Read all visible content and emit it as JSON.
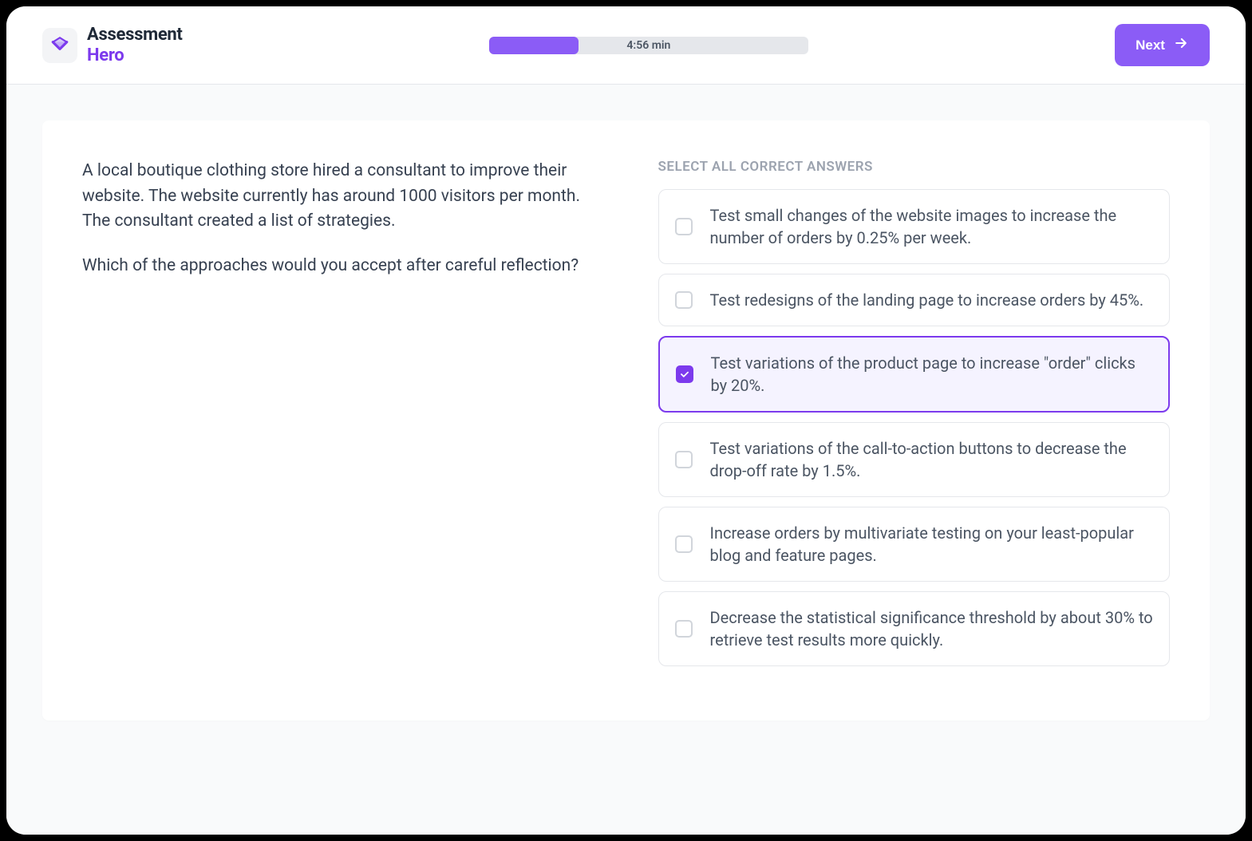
{
  "brand": {
    "line1": "Assessment",
    "line2": "Hero"
  },
  "timer": {
    "text": "4:56 min",
    "progress_percent": 28
  },
  "actions": {
    "next_label": "Next"
  },
  "question": {
    "paragraph1": "A local boutique clothing store hired a consultant to improve their website. The website currently has around 1000 visitors per month. The consultant created a list of strategies.",
    "paragraph2": "Which of the approaches would you accept after careful reflection?"
  },
  "answers": {
    "heading": "SELECT ALL CORRECT ANSWERS",
    "options": [
      {
        "text": "Test small changes of the website images to increase the number of orders by 0.25% per week.",
        "selected": false
      },
      {
        "text": "Test redesigns of the landing page to increase orders by 45%.",
        "selected": false
      },
      {
        "text": "Test variations of the product page to increase \"order\" clicks by 20%.",
        "selected": true
      },
      {
        "text": "Test variations of the call-to-action buttons to decrease the drop-off rate by 1.5%.",
        "selected": false
      },
      {
        "text": "Increase orders by multivariate testing on your least-popular blog and feature pages.",
        "selected": false
      },
      {
        "text": "Decrease the statistical significance threshold by about 30% to retrieve test results more quickly.",
        "selected": false
      }
    ]
  }
}
